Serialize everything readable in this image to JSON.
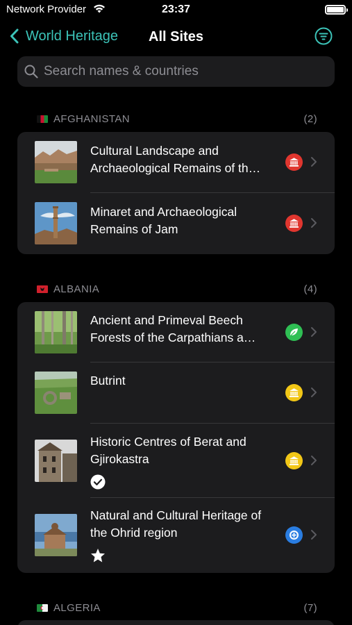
{
  "status_bar": {
    "carrier": "Network Provider",
    "time": "23:37"
  },
  "nav": {
    "back_label": "World Heritage",
    "title": "All Sites",
    "filter_icon": "filter-icon",
    "accent": "#3cc3b8"
  },
  "search": {
    "placeholder": "Search names & countries"
  },
  "sections": [
    {
      "country": "AFGHANISTAN",
      "count": "(2)",
      "items": [
        {
          "title": "Cultural Landscape and Archaeological Remains of th…",
          "category": "cultural",
          "badge_color": "#e0362f"
        },
        {
          "title": "Minaret and Archaeological Remains of Jam",
          "category": "cultural",
          "badge_color": "#e0362f"
        }
      ]
    },
    {
      "country": "ALBANIA",
      "count": "(4)",
      "items": [
        {
          "title": "Ancient and Primeval Beech Forests of the Carpathians a…",
          "category": "natural",
          "badge_color": "#2fbf54"
        },
        {
          "title": "Butrint",
          "category": "cultural",
          "badge_color": "#f2c717"
        },
        {
          "title": "Historic Centres of Berat and Gjirokastra",
          "category": "cultural",
          "badge_color": "#f2c717",
          "mark": "checkmark-icon"
        },
        {
          "title": "Natural and Cultural Heritage of the Ohrid region",
          "category": "mixed",
          "badge_color": "#2a7de1",
          "mark": "star-icon"
        }
      ]
    },
    {
      "country": "ALGERIA",
      "count": "(7)",
      "items": []
    }
  ]
}
